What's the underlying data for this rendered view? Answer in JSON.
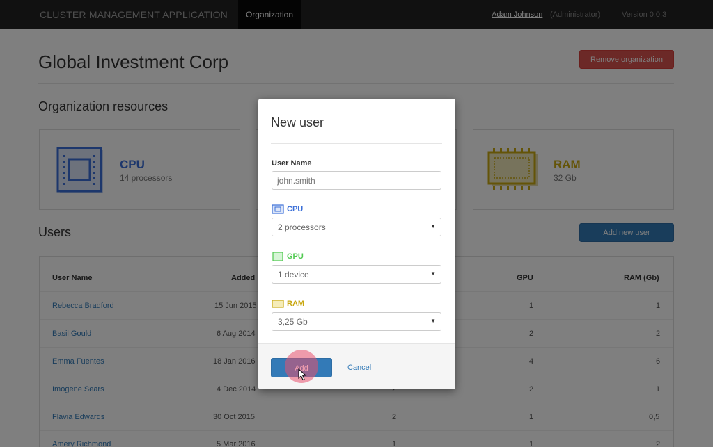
{
  "navbar": {
    "brand": "CLUSTER MANAGEMENT APPLICATION",
    "active_tab": "Organization",
    "user_name": "Adam Johnson",
    "user_role": "(Administrator)",
    "version": "Version 0.0.3"
  },
  "page": {
    "title": "Global Investment Corp",
    "remove_button": "Remove organization",
    "resources_title": "Organization resources",
    "resources": [
      {
        "name": "CPU",
        "value": "14 processors",
        "color": "#3b6fd8",
        "icon": "cpu-chip-icon"
      },
      {
        "name": "RAM",
        "value": "32 Gb",
        "color": "#c9a811",
        "icon": "ram-chip-icon"
      }
    ],
    "users_title": "Users",
    "add_user_button": "Add new user"
  },
  "users_table": {
    "headers": {
      "name": "User Name",
      "added": "Added",
      "gpu": "GPU",
      "ram": "RAM (Gb)"
    },
    "rows": [
      {
        "name": "Rebecca Bradford",
        "added": "15 Jun 2015",
        "cpu": "",
        "gpu": "1",
        "ram": "1"
      },
      {
        "name": "Basil Gould",
        "added": "6 Aug 2014",
        "cpu": "",
        "gpu": "2",
        "ram": "2"
      },
      {
        "name": "Emma Fuentes",
        "added": "18 Jan 2016",
        "cpu": "",
        "gpu": "4",
        "ram": "6"
      },
      {
        "name": "Imogene Sears",
        "added": "4 Dec 2014",
        "cpu": "2",
        "gpu": "2",
        "ram": "1"
      },
      {
        "name": "Flavia Edwards",
        "added": "30 Oct 2015",
        "cpu": "2",
        "gpu": "1",
        "ram": "0,5"
      },
      {
        "name": "Amery Richmond",
        "added": "5 Mar 2016",
        "cpu": "1",
        "gpu": "1",
        "ram": "2"
      }
    ]
  },
  "modal": {
    "title": "New user",
    "user_name_label": "User Name",
    "user_name_placeholder": "john.smith",
    "cpu_label": "CPU",
    "cpu_value": "2 processors",
    "gpu_label": "GPU",
    "gpu_value": "1 device",
    "ram_label": "RAM",
    "ram_value": "3,25 Gb",
    "add_button": "Add",
    "cancel_button": "Cancel",
    "colors": {
      "cpu": "#3b6fd8",
      "gpu": "#4fc94f",
      "ram": "#c9a811"
    }
  }
}
